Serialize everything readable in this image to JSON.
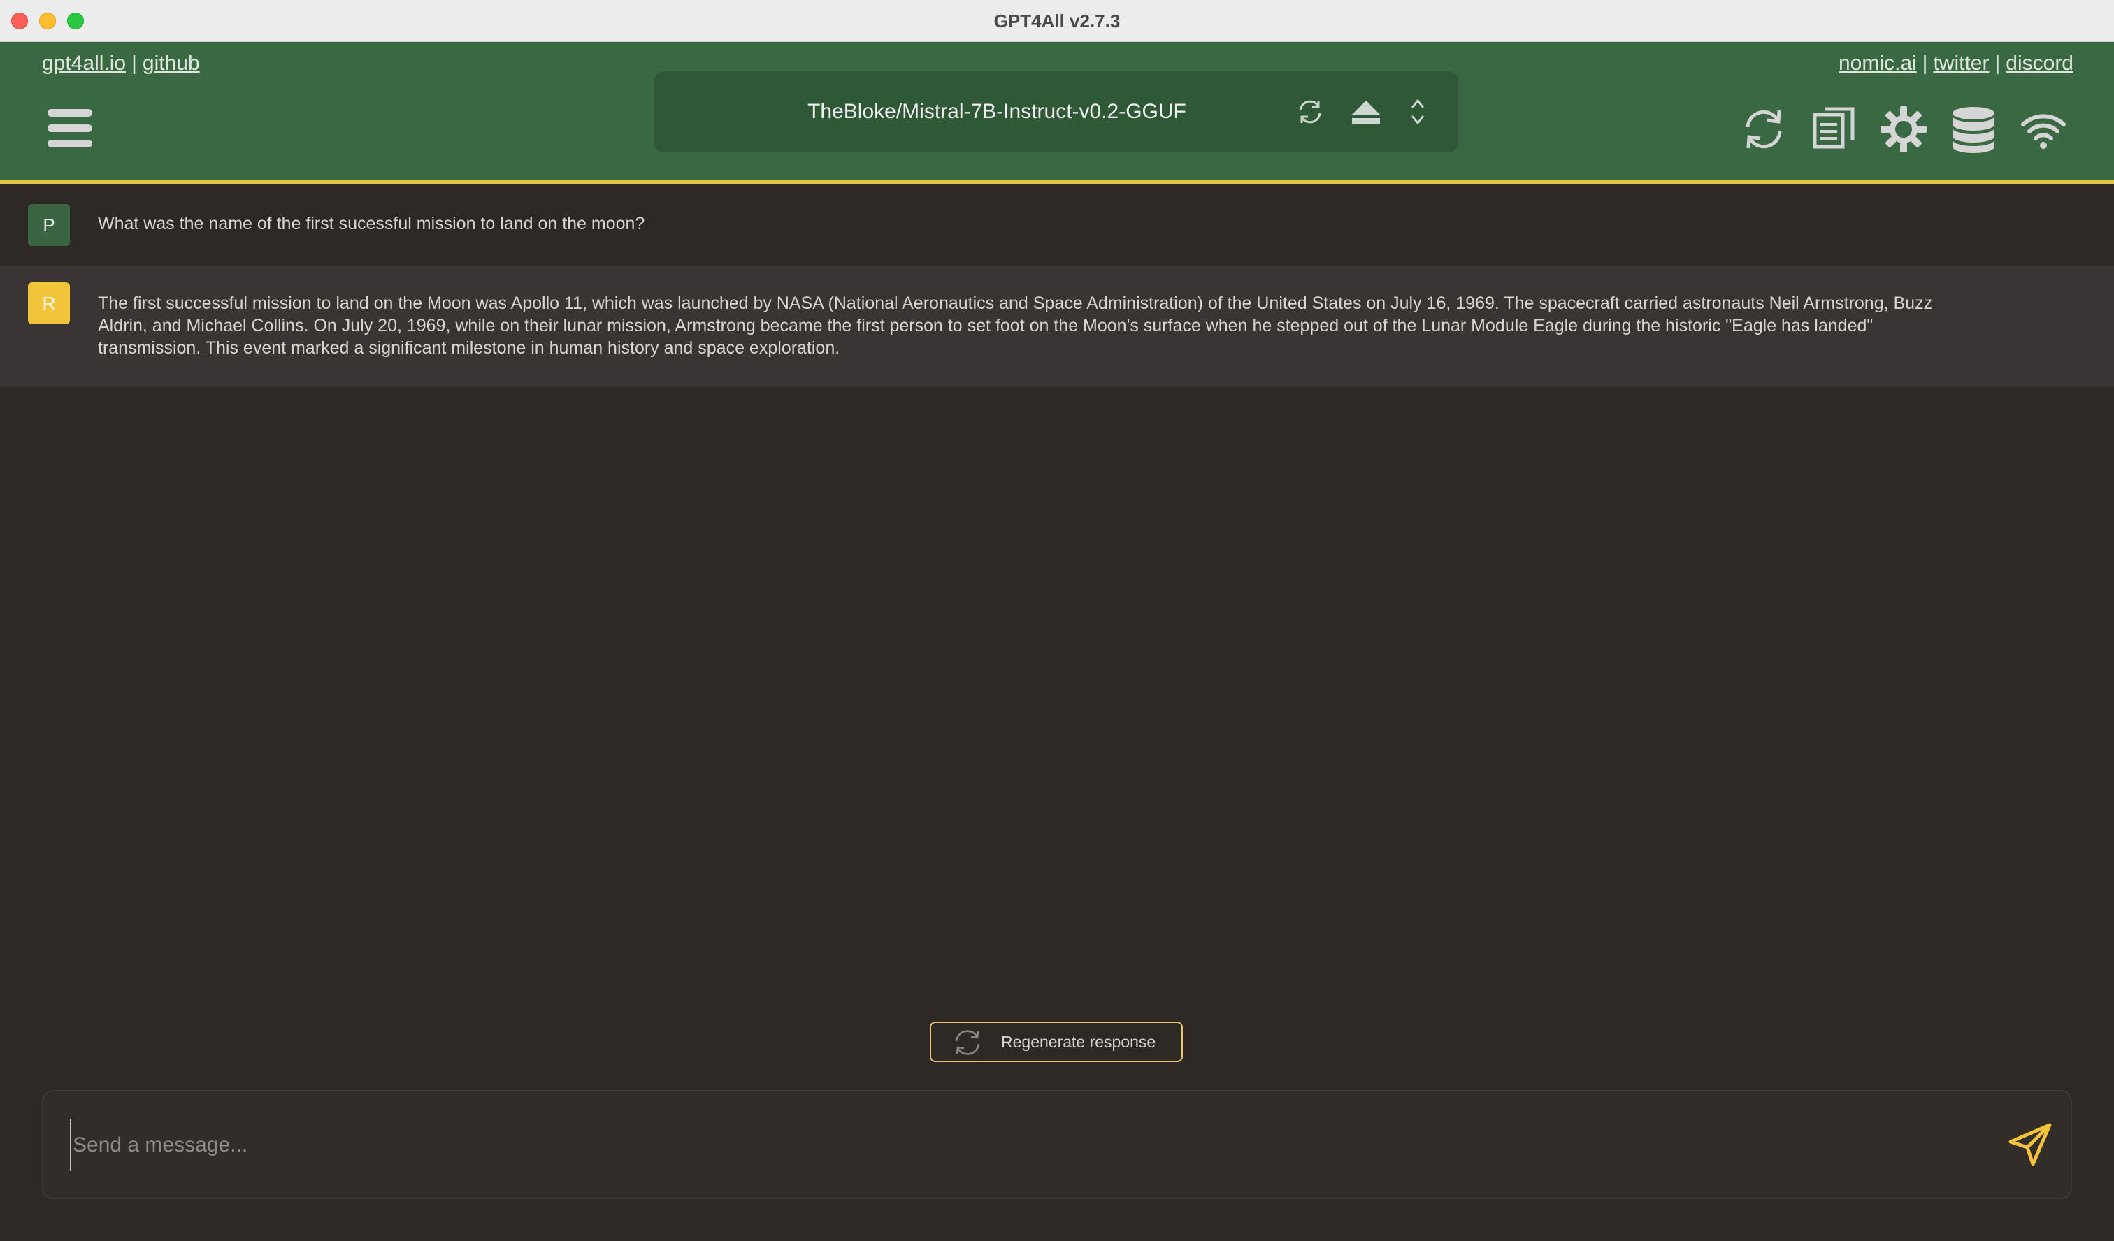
{
  "window": {
    "title": "GPT4All v2.7.3"
  },
  "header": {
    "links_left": [
      "gpt4all.io",
      "github"
    ],
    "links_right": [
      "nomic.ai",
      "twitter",
      "discord"
    ],
    "separator": "|",
    "model_name": "TheBloke/Mistral-7B-Instruct-v0.2-GGUF",
    "model_icons": [
      "reload-icon",
      "eject-icon",
      "chevron-up-down-icon"
    ],
    "toolbar_icons": [
      "refresh-icon",
      "copy-icon",
      "settings-icon",
      "database-icon",
      "network-icon"
    ]
  },
  "messages": [
    {
      "role_initial": "P",
      "text": "What was the name of the first sucessful mission to land on the moon?"
    },
    {
      "role_initial": "R",
      "text": "The first successful mission to land on the Moon was Apollo 11, which was launched by NASA (National Aeronautics and Space Administration) of the United States on July 16, 1969. The spacecraft carried astronauts Neil Armstrong, Buzz Aldrin, and Michael Collins. On July 20, 1969, while on their lunar mission, Armstrong became the first person to set foot on the Moon's surface when he stepped out of the Lunar Module Eagle during the historic \"Eagle has landed\" transmission. This event marked a significant milestone in human history and space exploration."
    }
  ],
  "regenerate": {
    "label": "Regenerate response"
  },
  "input": {
    "placeholder": "Send a message...",
    "value": ""
  },
  "colors": {
    "header": "#3a6842",
    "accent": "#e3c14a",
    "background": "#2e2925",
    "send": "#f3c43a"
  }
}
